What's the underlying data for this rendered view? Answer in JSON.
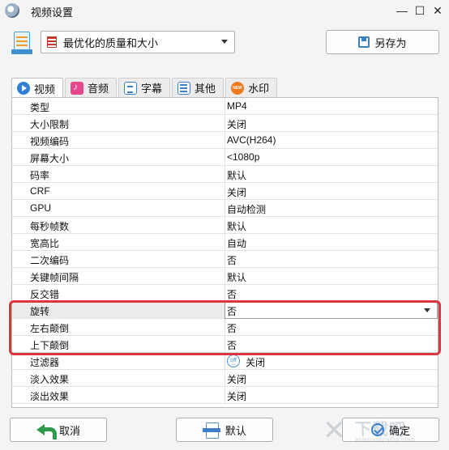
{
  "window": {
    "title": "视频设置",
    "minimize": "—",
    "maximize": "☐",
    "close": "✕"
  },
  "preset": {
    "value": "最优化的质量和大小",
    "save_as": "另存为"
  },
  "tabs": [
    {
      "label": "视频",
      "icon": "play-icon"
    },
    {
      "label": "音频",
      "icon": "music-note-icon"
    },
    {
      "label": "字幕",
      "icon": "subtitle-icon"
    },
    {
      "label": "其他",
      "icon": "settings-sliders-icon"
    },
    {
      "label": "水印",
      "icon": "new-badge-icon"
    }
  ],
  "settings": [
    {
      "key": "类型",
      "value": "MP4"
    },
    {
      "key": "大小限制",
      "value": "关闭"
    },
    {
      "key": "视频编码",
      "value": "AVC(H264)"
    },
    {
      "key": "屏幕大小",
      "value": "<1080p"
    },
    {
      "key": "码率",
      "value": "默认"
    },
    {
      "key": "CRF",
      "value": "关闭"
    },
    {
      "key": "GPU",
      "value": "自动检测"
    },
    {
      "key": "每秒帧数",
      "value": "默认"
    },
    {
      "key": "宽高比",
      "value": "自动"
    },
    {
      "key": "二次编码",
      "value": "否"
    },
    {
      "key": "关键帧间隔",
      "value": "默认"
    },
    {
      "key": "反交错",
      "value": "否"
    },
    {
      "key": "旋转",
      "value": "否"
    },
    {
      "key": "左右颠倒",
      "value": "否"
    },
    {
      "key": "上下颠倒",
      "value": "否"
    },
    {
      "key": "过滤器",
      "value": "关闭",
      "toggle": "off"
    },
    {
      "key": "淡入效果",
      "value": "关闭"
    },
    {
      "key": "淡出效果",
      "value": "关闭"
    }
  ],
  "buttons": {
    "cancel": "取消",
    "default": "默认",
    "ok": "确定"
  },
  "watermark": {
    "brand": "下载吧",
    "url": "www.xiazaiba.com"
  },
  "colors": {
    "highlight": "#d9363e",
    "accent": "#2f7fd8"
  }
}
